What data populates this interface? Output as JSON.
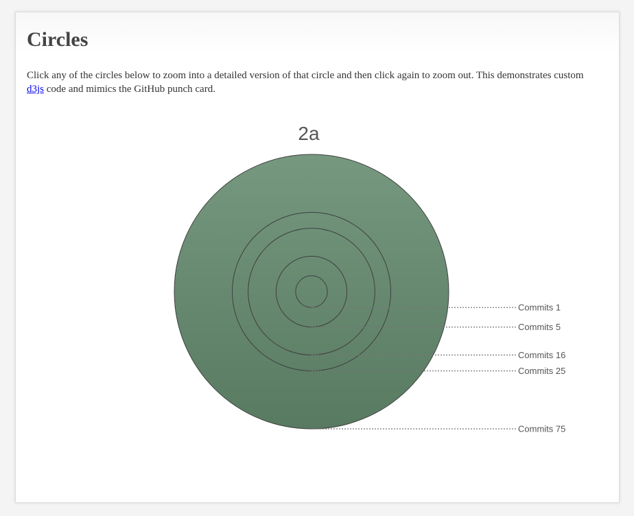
{
  "page": {
    "title": "Circles",
    "intro_before_link": "Click any of the circles below to zoom into a detailed version of that circle and then click again to zoom out. This demonstrates custom ",
    "link_text": "d3js",
    "intro_after_link": " code and mimics the GitHub punch card."
  },
  "diagram": {
    "heading": "2a",
    "fill_color_top": "#76987f",
    "fill_color_bottom": "#587a61",
    "stroke_color": "#3f3f3f",
    "leader_color": "#777777",
    "rings": [
      {
        "label": "Commits 1",
        "value": 1
      },
      {
        "label": "Commits 5",
        "value": 5
      },
      {
        "label": "Commits 16",
        "value": 16
      },
      {
        "label": "Commits 25",
        "value": 25
      },
      {
        "label": "Commits 75",
        "value": 75
      }
    ]
  }
}
